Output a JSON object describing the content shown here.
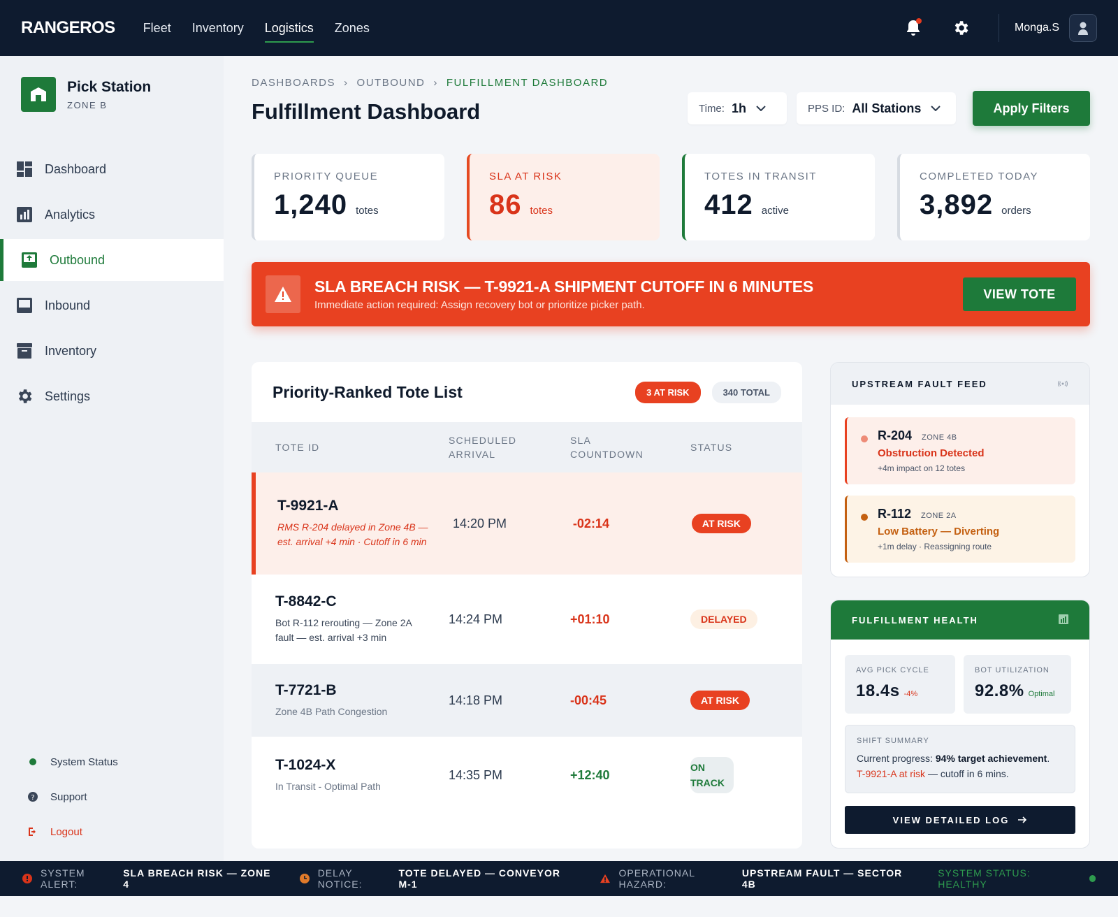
{
  "topbar": {
    "brand": "RANGEROS",
    "nav": [
      "Fleet",
      "Inventory",
      "Logistics",
      "Zones"
    ],
    "active_nav": "Logistics",
    "user_name": "Monga.S"
  },
  "sidebar": {
    "station_title": "Pick Station",
    "station_zone": "ZONE B",
    "items": [
      {
        "label": "Dashboard",
        "icon": "grid-icon"
      },
      {
        "label": "Analytics",
        "icon": "chart-icon"
      },
      {
        "label": "Outbound",
        "icon": "outbound-icon"
      },
      {
        "label": "Inbound",
        "icon": "inbox-icon"
      },
      {
        "label": "Inventory",
        "icon": "archive-icon"
      },
      {
        "label": "Settings",
        "icon": "gear-icon"
      }
    ],
    "active_item": "Outbound",
    "bottom": {
      "system_status": "System Status",
      "support": "Support",
      "logout": "Logout"
    }
  },
  "header": {
    "breadcrumb": [
      "DASHBOARDS",
      "OUTBOUND",
      "FULFILLMENT DASHBOARD"
    ],
    "title": "Fulfillment Dashboard",
    "time_label": "Time:",
    "time_value": "1h",
    "pps_label": "PPS ID:",
    "pps_value": "All Stations",
    "apply_label": "Apply Filters"
  },
  "kpis": [
    {
      "label": "PRIORITY QUEUE",
      "value": "1,240",
      "unit": "totes"
    },
    {
      "label": "SLA AT RISK",
      "value": "86",
      "unit": "totes"
    },
    {
      "label": "TOTES IN TRANSIT",
      "value": "412",
      "unit": "active"
    },
    {
      "label": "COMPLETED TODAY",
      "value": "3,892",
      "unit": "orders"
    }
  ],
  "alert": {
    "title": "SLA BREACH RISK — T-9921-A SHIPMENT CUTOFF IN 6 MINUTES",
    "subtitle": "Immediate action required: Assign recovery bot or prioritize picker path.",
    "button": "VIEW TOTE"
  },
  "tote_list": {
    "title": "Priority-Ranked Tote List",
    "risk_badge": "3 AT RISK",
    "total_badge": "340 TOTAL",
    "columns": {
      "id": "TOTE ID",
      "arrival": "SCHEDULED ARRIVAL",
      "countdown": "SLA COUNTDOWN",
      "status": "STATUS"
    },
    "rows": [
      {
        "id": "T-9921-A",
        "note": "RMS R-204 delayed in Zone 4B — est. arrival +4 min · Cutoff in 6 min",
        "arrival": "14:20 PM",
        "countdown": "-02:14",
        "status": "AT RISK"
      },
      {
        "id": "T-8842-C",
        "note": "Bot R-112 rerouting — Zone 2A fault — est. arrival +3 min",
        "arrival": "14:24 PM",
        "countdown": "+01:10",
        "status": "DELAYED"
      },
      {
        "id": "T-7721-B",
        "note": "Zone 4B Path Congestion",
        "arrival": "14:18 PM",
        "countdown": "-00:45",
        "status": "AT RISK"
      },
      {
        "id": "T-1024-X",
        "note": "In Transit - Optimal Path",
        "arrival": "14:35 PM",
        "countdown": "+12:40",
        "status": "ON TRACK"
      }
    ]
  },
  "fault_feed": {
    "title": "UPSTREAM FAULT FEED",
    "items": [
      {
        "id": "R-204",
        "zone": "ZONE 4B",
        "msg": "Obstruction Detected",
        "meta": "+4m impact on 12 totes"
      },
      {
        "id": "R-112",
        "zone": "ZONE 2A",
        "msg": "Low Battery — Diverting",
        "meta": "+1m delay · Reassigning route"
      }
    ]
  },
  "health": {
    "title": "FULFILLMENT HEALTH",
    "stats": [
      {
        "label": "AVG PICK CYCLE",
        "value": "18.4s",
        "sub": "-4%"
      },
      {
        "label": "BOT UTILIZATION",
        "value": "92.8%",
        "sub": "Optimal"
      }
    ],
    "shift_label": "SHIFT SUMMARY",
    "shift_prefix": "Current progress:",
    "shift_bold": "94% target achievement",
    "shift_period": ".",
    "shift_risk": "T-9921-A at risk",
    "shift_tail": "— cutoff in 6 mins.",
    "log_button": "VIEW DETAILED LOG"
  },
  "ticker": [
    {
      "label": "SYSTEM ALERT:",
      "value": "SLA BREACH RISK — ZONE 4"
    },
    {
      "label": "DELAY NOTICE:",
      "value": "TOTE DELAYED — CONVEYOR M-1"
    },
    {
      "label": "OPERATIONAL HAZARD:",
      "value": "UPSTREAM FAULT — SECTOR 4B"
    }
  ],
  "ticker_status": "SYSTEM STATUS: HEALTHY",
  "colors": {
    "brand_green": "#1e7a3a",
    "danger": "#e84121",
    "navy": "#0e1b2f",
    "warning": "#c46011"
  }
}
